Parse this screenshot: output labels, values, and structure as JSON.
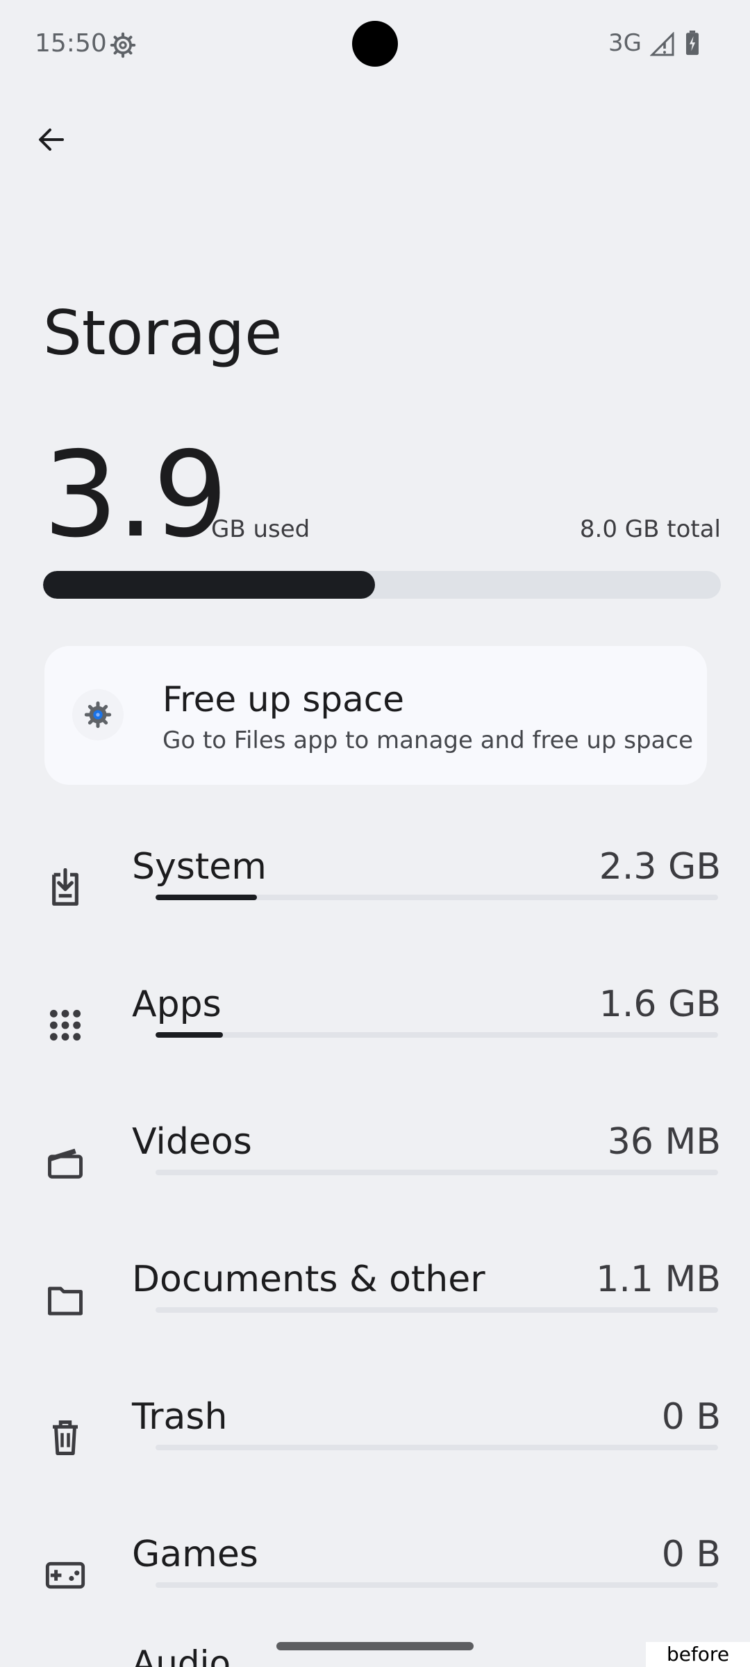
{
  "status_bar": {
    "time": "15:50",
    "network": "3G",
    "icons": [
      "settings-gear-icon",
      "signal-icon",
      "battery-charging-icon"
    ]
  },
  "app_bar": {
    "back_icon": "arrow-left-icon"
  },
  "page_title": "Storage",
  "summary": {
    "used_value": "3.9",
    "used_unit": "GB used",
    "total_label": "8.0 GB total",
    "used_fraction": 0.49
  },
  "free_up_card": {
    "title": "Free up space",
    "subtitle": "Go to Files app to manage and free up space",
    "icon": "files-gear-icon"
  },
  "categories": [
    {
      "label": "System",
      "size": "2.3 GB",
      "icon": "system-download-icon",
      "fraction": 0.18
    },
    {
      "label": "Apps",
      "size": "1.6 GB",
      "icon": "apps-grid-icon",
      "fraction": 0.12
    },
    {
      "label": "Videos",
      "size": "36 MB",
      "icon": "video-clapper-icon",
      "fraction": 0.0
    },
    {
      "label": "Documents & other",
      "size": "1.1 MB",
      "icon": "folder-icon",
      "fraction": 0.0
    },
    {
      "label": "Trash",
      "size": "0 B",
      "icon": "trash-icon",
      "fraction": 0.0
    },
    {
      "label": "Games",
      "size": "0 B",
      "icon": "gamepad-icon",
      "fraction": 0.0
    }
  ],
  "bottom_partial_label": "Audio",
  "tag": "before"
}
